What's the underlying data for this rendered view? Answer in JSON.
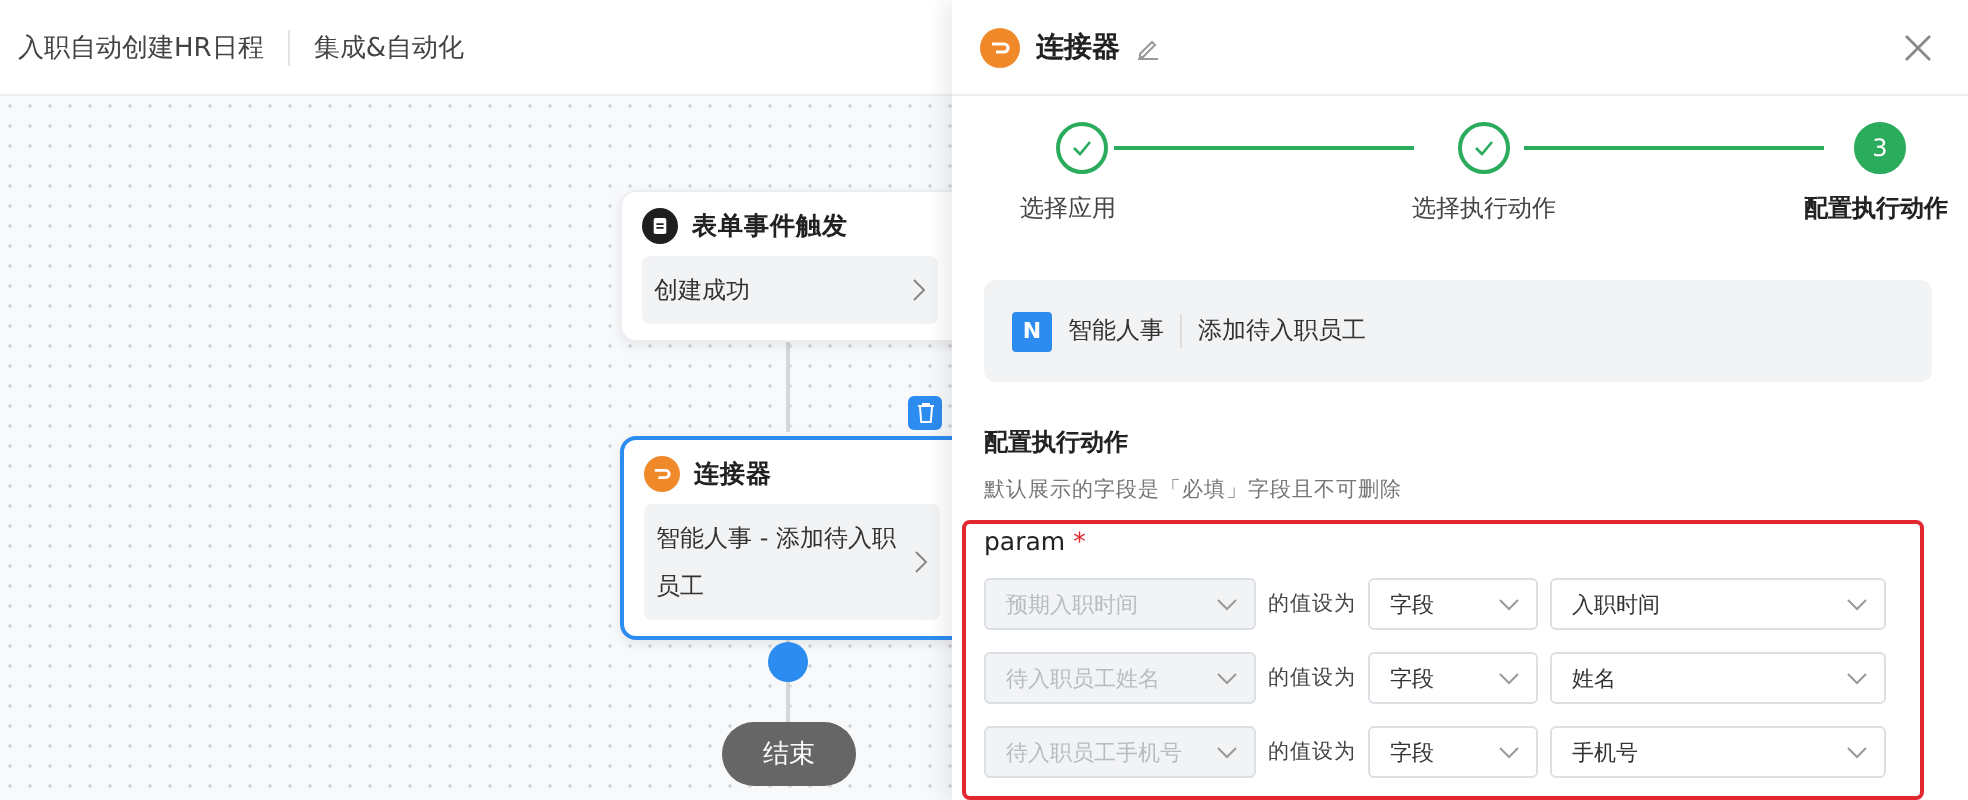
{
  "breadcrumb": [
    "入职自动创建HR日程",
    "集成&自动化"
  ],
  "flow": {
    "nodes": [
      {
        "kind": "trigger",
        "title": "表单事件触发",
        "detail": "创建成功",
        "selected": false
      },
      {
        "kind": "connector",
        "title": "连接器",
        "detail": "智能人事 - 添加待入职员工",
        "selected": true
      },
      {
        "kind": "end",
        "title": "结束",
        "selected": false
      }
    ]
  },
  "panel": {
    "title": "连接器",
    "steps": [
      {
        "label": "选择应用",
        "done": true,
        "selected": false
      },
      {
        "label": "选择执行动作",
        "done": true,
        "selected": false
      },
      {
        "label": "配置执行动作",
        "number": "3",
        "done": false,
        "selected": true
      }
    ],
    "app": {
      "badge": "N",
      "name": "智能人事",
      "action": "添加待入职员工"
    },
    "section_title": "配置执行动作",
    "section_hint": "默认展示的字段是「必填」字段且不可删除",
    "param": {
      "label": "param",
      "required_mark": "*",
      "error": true,
      "rows": [
        {
          "field": "预期入职时间",
          "field_disabled": true,
          "verb": "的值设为",
          "type": "字段",
          "value": "入职时间"
        },
        {
          "field": "待入职员工姓名",
          "field_disabled": true,
          "verb": "的值设为",
          "type": "字段",
          "value": "姓名"
        },
        {
          "field": "待入职员工手机号",
          "field_disabled": true,
          "verb": "的值设为",
          "type": "字段",
          "value": "手机号"
        }
      ]
    }
  }
}
